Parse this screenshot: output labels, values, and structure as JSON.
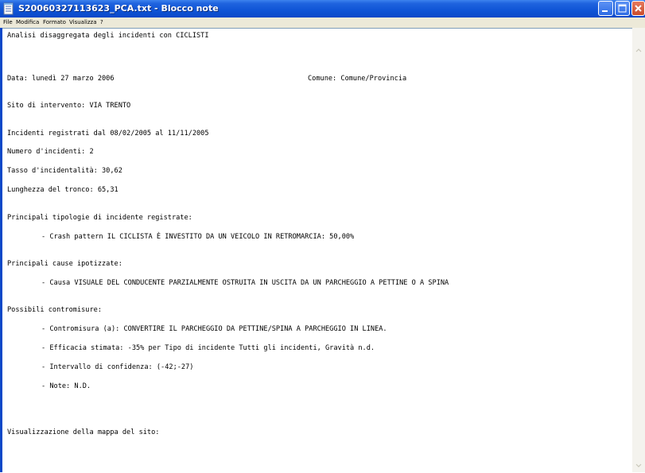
{
  "window": {
    "title": "S20060327113623_PCA.txt - Blocco note",
    "accent_color": "#0a48c8"
  },
  "menu": {
    "items": [
      "File",
      "Modifica",
      "Formato",
      "Visualizza",
      "?"
    ]
  },
  "document": {
    "line1": "Analisi disaggregata degli incidenti con CICLISTI",
    "date": "Data: lunedì 27 marzo 2006",
    "comune": "Comune: Comune/Provincia",
    "sito": "Sito di intervento: VIA TRENTO",
    "periodo": "Incidenti registrati dal 08/02/2005 al 11/11/2005",
    "numero": "Numero d'incidenti: 2",
    "tasso": "Tasso d'incidentalità: 30,62",
    "lunghezza": "Lunghezza del tronco: 65,31",
    "tipologie_heading": "Principali tipologie di incidente registrate:",
    "tipologie_item": "- Crash pattern IL CICLISTA È INVESTITO DA UN VEICOLO IN RETROMARCIA: 50,00%",
    "cause_heading": "Principali cause ipotizzate:",
    "cause_item": "- Causa VISUALE DEL CONDUCENTE PARZIALMENTE OSTRUITA IN USCITA DA UN PARCHEGGIO A PETTINE O A SPINA",
    "contromisure_heading": "Possibili contromisure:",
    "contromisura_a": "- Contromisura (a): CONVERTIRE IL PARCHEGGIO DA PETTINE/SPINA A PARCHEGGIO IN LINEA.",
    "efficacia": "- Efficacia stimata: -35% per Tipo di incidente Tutti gli incidenti, Gravità n.d.",
    "intervallo": "- Intervallo di confidenza: (-42;-27)",
    "note": "- Note: N.D.",
    "mappa": "Visualizzazione della mappa del sito:"
  }
}
